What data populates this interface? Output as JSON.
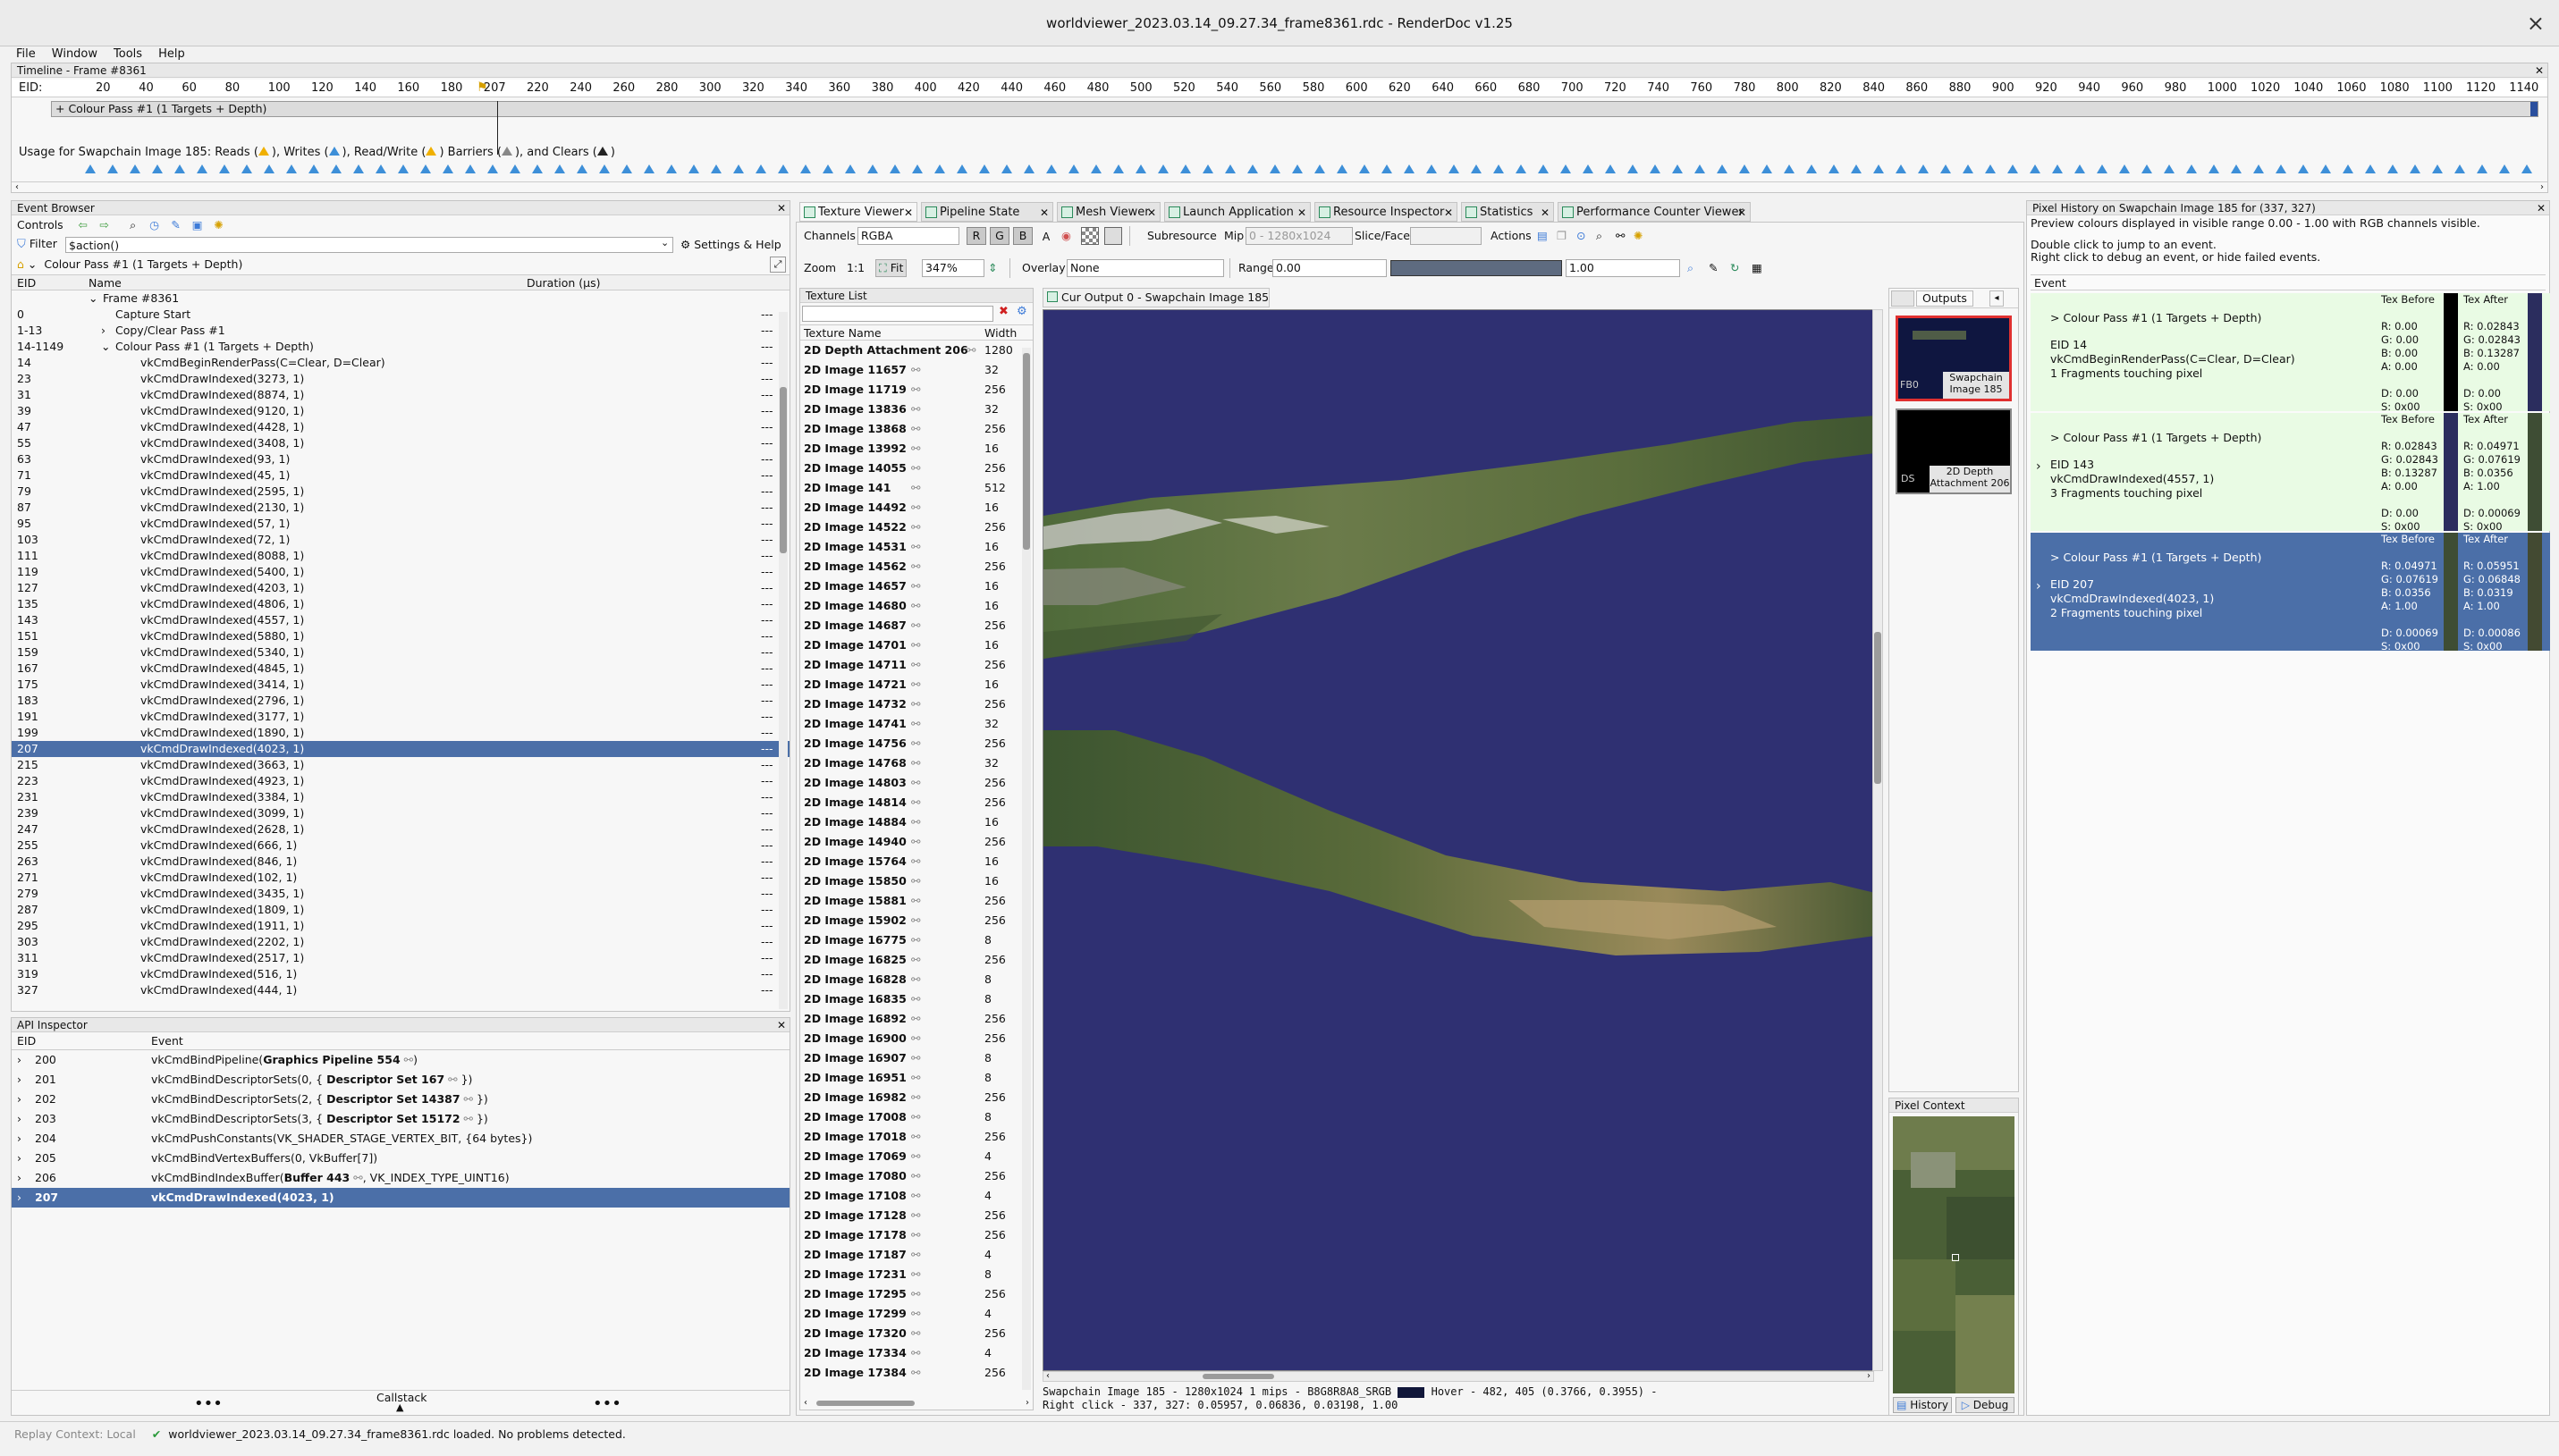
{
  "window": {
    "title": "worldviewer_2023.03.14_09.27.34_frame8361.rdc - RenderDoc v1.25",
    "close": "×"
  },
  "menu": [
    "File",
    "Window",
    "Tools",
    "Help"
  ],
  "timeline": {
    "title": "Timeline - Frame #8361",
    "eid_label": "EID:",
    "ticks": [
      "20",
      "40",
      "60",
      "80",
      "100",
      "120",
      "140",
      "160",
      "180",
      "207",
      "220",
      "240",
      "260",
      "280",
      "300",
      "320",
      "340",
      "360",
      "380",
      "400",
      "420",
      "440",
      "460",
      "480",
      "500",
      "520",
      "540",
      "560",
      "580",
      "600",
      "620",
      "640",
      "660",
      "680",
      "700",
      "720",
      "740",
      "760",
      "780",
      "800",
      "820",
      "840",
      "860",
      "880",
      "900",
      "920",
      "940",
      "960",
      "980",
      "1000",
      "1020",
      "1040",
      "1060",
      "1080",
      "1100",
      "1120",
      "1140"
    ],
    "pass_label": "+ Colour Pass #1 (1 Targets + Depth)",
    "usage_prefix": "Usage for Swapchain Image 185: Reads (",
    "usage_mid1": "), Writes (",
    "usage_mid2": "), Read/Write (",
    "usage_mid3": ") Barriers (",
    "usage_mid4": "), and Clears (",
    "usage_end": ")"
  },
  "event_browser": {
    "title": "Event Browser",
    "controls_label": "Controls",
    "filter_label": "Filter",
    "filter_value": "$action()",
    "settings_label": "Settings & Help",
    "breadcrumb": "Colour Pass #1 (1 Targets + Depth)",
    "col_eid": "EID",
    "col_name": "Name",
    "col_duration": "Duration (µs)",
    "rows": [
      {
        "eid": "",
        "name": "Frame #8361",
        "indent": 1,
        "exp": "⌄",
        "dur": ""
      },
      {
        "eid": "0",
        "name": "Capture Start",
        "indent": 2,
        "exp": "",
        "dur": "---"
      },
      {
        "eid": "1-13",
        "name": "Copy/Clear Pass #1",
        "indent": 2,
        "exp": "›",
        "dur": "---"
      },
      {
        "eid": "14-1149",
        "name": "Colour Pass #1 (1 Targets + Depth)",
        "indent": 2,
        "exp": "⌄",
        "dur": "---"
      },
      {
        "eid": "14",
        "name": "vkCmdBeginRenderPass(C=Clear, D=Clear)",
        "indent": 3,
        "exp": "",
        "dur": "---"
      },
      {
        "eid": "23",
        "name": "vkCmdDrawIndexed(3273, 1)",
        "indent": 3,
        "exp": "",
        "dur": "---"
      },
      {
        "eid": "31",
        "name": "vkCmdDrawIndexed(8874, 1)",
        "indent": 3,
        "exp": "",
        "dur": "---"
      },
      {
        "eid": "39",
        "name": "vkCmdDrawIndexed(9120, 1)",
        "indent": 3,
        "exp": "",
        "dur": "---"
      },
      {
        "eid": "47",
        "name": "vkCmdDrawIndexed(4428, 1)",
        "indent": 3,
        "exp": "",
        "dur": "---"
      },
      {
        "eid": "55",
        "name": "vkCmdDrawIndexed(3408, 1)",
        "indent": 3,
        "exp": "",
        "dur": "---"
      },
      {
        "eid": "63",
        "name": "vkCmdDrawIndexed(93, 1)",
        "indent": 3,
        "exp": "",
        "dur": "---"
      },
      {
        "eid": "71",
        "name": "vkCmdDrawIndexed(45, 1)",
        "indent": 3,
        "exp": "",
        "dur": "---"
      },
      {
        "eid": "79",
        "name": "vkCmdDrawIndexed(2595, 1)",
        "indent": 3,
        "exp": "",
        "dur": "---"
      },
      {
        "eid": "87",
        "name": "vkCmdDrawIndexed(2130, 1)",
        "indent": 3,
        "exp": "",
        "dur": "---"
      },
      {
        "eid": "95",
        "name": "vkCmdDrawIndexed(57, 1)",
        "indent": 3,
        "exp": "",
        "dur": "---"
      },
      {
        "eid": "103",
        "name": "vkCmdDrawIndexed(72, 1)",
        "indent": 3,
        "exp": "",
        "dur": "---"
      },
      {
        "eid": "111",
        "name": "vkCmdDrawIndexed(8088, 1)",
        "indent": 3,
        "exp": "",
        "dur": "---"
      },
      {
        "eid": "119",
        "name": "vkCmdDrawIndexed(5400, 1)",
        "indent": 3,
        "exp": "",
        "dur": "---"
      },
      {
        "eid": "127",
        "name": "vkCmdDrawIndexed(4203, 1)",
        "indent": 3,
        "exp": "",
        "dur": "---"
      },
      {
        "eid": "135",
        "name": "vkCmdDrawIndexed(4806, 1)",
        "indent": 3,
        "exp": "",
        "dur": "---"
      },
      {
        "eid": "143",
        "name": "vkCmdDrawIndexed(4557, 1)",
        "indent": 3,
        "exp": "",
        "dur": "---"
      },
      {
        "eid": "151",
        "name": "vkCmdDrawIndexed(5880, 1)",
        "indent": 3,
        "exp": "",
        "dur": "---"
      },
      {
        "eid": "159",
        "name": "vkCmdDrawIndexed(5340, 1)",
        "indent": 3,
        "exp": "",
        "dur": "---"
      },
      {
        "eid": "167",
        "name": "vkCmdDrawIndexed(4845, 1)",
        "indent": 3,
        "exp": "",
        "dur": "---"
      },
      {
        "eid": "175",
        "name": "vkCmdDrawIndexed(3414, 1)",
        "indent": 3,
        "exp": "",
        "dur": "---"
      },
      {
        "eid": "183",
        "name": "vkCmdDrawIndexed(2796, 1)",
        "indent": 3,
        "exp": "",
        "dur": "---"
      },
      {
        "eid": "191",
        "name": "vkCmdDrawIndexed(3177, 1)",
        "indent": 3,
        "exp": "",
        "dur": "---"
      },
      {
        "eid": "199",
        "name": "vkCmdDrawIndexed(1890, 1)",
        "indent": 3,
        "exp": "",
        "dur": "---"
      },
      {
        "eid": "207",
        "name": "vkCmdDrawIndexed(4023, 1)",
        "indent": 3,
        "exp": "",
        "dur": "---",
        "selected": true
      },
      {
        "eid": "215",
        "name": "vkCmdDrawIndexed(3663, 1)",
        "indent": 3,
        "exp": "",
        "dur": "---"
      },
      {
        "eid": "223",
        "name": "vkCmdDrawIndexed(4923, 1)",
        "indent": 3,
        "exp": "",
        "dur": "---"
      },
      {
        "eid": "231",
        "name": "vkCmdDrawIndexed(3384, 1)",
        "indent": 3,
        "exp": "",
        "dur": "---"
      },
      {
        "eid": "239",
        "name": "vkCmdDrawIndexed(3099, 1)",
        "indent": 3,
        "exp": "",
        "dur": "---"
      },
      {
        "eid": "247",
        "name": "vkCmdDrawIndexed(2628, 1)",
        "indent": 3,
        "exp": "",
        "dur": "---"
      },
      {
        "eid": "255",
        "name": "vkCmdDrawIndexed(666, 1)",
        "indent": 3,
        "exp": "",
        "dur": "---"
      },
      {
        "eid": "263",
        "name": "vkCmdDrawIndexed(846, 1)",
        "indent": 3,
        "exp": "",
        "dur": "---"
      },
      {
        "eid": "271",
        "name": "vkCmdDrawIndexed(102, 1)",
        "indent": 3,
        "exp": "",
        "dur": "---"
      },
      {
        "eid": "279",
        "name": "vkCmdDrawIndexed(3435, 1)",
        "indent": 3,
        "exp": "",
        "dur": "---"
      },
      {
        "eid": "287",
        "name": "vkCmdDrawIndexed(1809, 1)",
        "indent": 3,
        "exp": "",
        "dur": "---"
      },
      {
        "eid": "295",
        "name": "vkCmdDrawIndexed(1911, 1)",
        "indent": 3,
        "exp": "",
        "dur": "---"
      },
      {
        "eid": "303",
        "name": "vkCmdDrawIndexed(2202, 1)",
        "indent": 3,
        "exp": "",
        "dur": "---"
      },
      {
        "eid": "311",
        "name": "vkCmdDrawIndexed(2517, 1)",
        "indent": 3,
        "exp": "",
        "dur": "---"
      },
      {
        "eid": "319",
        "name": "vkCmdDrawIndexed(516, 1)",
        "indent": 3,
        "exp": "",
        "dur": "---"
      },
      {
        "eid": "327",
        "name": "vkCmdDrawIndexed(444, 1)",
        "indent": 3,
        "exp": "",
        "dur": "---"
      }
    ]
  },
  "api_inspector": {
    "title": "API Inspector",
    "col_eid": "EID",
    "col_event": "Event",
    "rows": [
      {
        "eid": "200",
        "pre": "vkCmdBindPipeline(",
        "bold": "Graphics Pipeline 554",
        "post": ")"
      },
      {
        "eid": "201",
        "pre": "vkCmdBindDescriptorSets(0, {  ",
        "bold": "Descriptor Set 167",
        "post": "  })"
      },
      {
        "eid": "202",
        "pre": "vkCmdBindDescriptorSets(2, {  ",
        "bold": "Descriptor Set 14387",
        "post": "  })"
      },
      {
        "eid": "203",
        "pre": "vkCmdBindDescriptorSets(3, {  ",
        "bold": "Descriptor Set 15172",
        "post": "  })"
      },
      {
        "eid": "204",
        "pre": "vkCmdPushConstants(VK_SHADER_STAGE_VERTEX_BIT, {64 bytes})",
        "bold": "",
        "post": ""
      },
      {
        "eid": "205",
        "pre": "vkCmdBindVertexBuffers(0, VkBuffer[7])",
        "bold": "",
        "post": ""
      },
      {
        "eid": "206",
        "pre": "vkCmdBindIndexBuffer(",
        "bold": "Buffer 443",
        "post": ", VK_INDEX_TYPE_UINT16)"
      },
      {
        "eid": "207",
        "pre": "vkCmdDrawIndexed(4023, 1)",
        "bold": "",
        "post": "",
        "selected": true
      }
    ],
    "callstack_label": "Callstack"
  },
  "tabs": [
    "Texture Viewer",
    "Pipeline State",
    "Mesh Viewer",
    "Launch Application",
    "Resource Inspector",
    "Statistics",
    "Performance Counter Viewer"
  ],
  "texture_viewer": {
    "channels_label": "Channels",
    "channels_value": "RGBA",
    "rgba_buttons": [
      "R",
      "G",
      "B",
      "A"
    ],
    "subresource_label": "Subresource",
    "mip_label": "Mip",
    "mip_value": "0 - 1280x1024",
    "slice_label": "Slice/Face",
    "actions_label": "Actions",
    "zoom_label": "Zoom",
    "zoom_11": "1:1",
    "fit_label": "Fit",
    "zoom_value": "347%",
    "overlay_label": "Overlay",
    "overlay_value": "None",
    "range_label": "Range",
    "range_min": "0.00",
    "range_max": "1.00",
    "output_tab": "Cur Output 0 - Swapchain Image 185",
    "status_line1": "Swapchain Image 185 - 1280x1024 1 mips - B8G8R8A8_SRGB",
    "hover_text": "Hover -    482,  405 (0.3766, 0.3955)  -",
    "status_line2": "Right click -   337,  327: 0.05957, 0.06836, 0.03198, 1.00",
    "hover_swatch": "#11173a"
  },
  "texture_list": {
    "title": "Texture List",
    "col_name": "Texture Name",
    "col_width": "Width",
    "items": [
      {
        "name": "2D Depth Attachment 206",
        "w": "1280"
      },
      {
        "name": "2D Image 11657",
        "w": "32"
      },
      {
        "name": "2D Image 11719",
        "w": "256"
      },
      {
        "name": "2D Image 13836",
        "w": "32"
      },
      {
        "name": "2D Image 13868",
        "w": "256"
      },
      {
        "name": "2D Image 13992",
        "w": "16"
      },
      {
        "name": "2D Image 14055",
        "w": "256"
      },
      {
        "name": "2D Image 141",
        "w": "512"
      },
      {
        "name": "2D Image 14492",
        "w": "16"
      },
      {
        "name": "2D Image 14522",
        "w": "256"
      },
      {
        "name": "2D Image 14531",
        "w": "16"
      },
      {
        "name": "2D Image 14562",
        "w": "256"
      },
      {
        "name": "2D Image 14657",
        "w": "16"
      },
      {
        "name": "2D Image 14680",
        "w": "16"
      },
      {
        "name": "2D Image 14687",
        "w": "256"
      },
      {
        "name": "2D Image 14701",
        "w": "16"
      },
      {
        "name": "2D Image 14711",
        "w": "256"
      },
      {
        "name": "2D Image 14721",
        "w": "16"
      },
      {
        "name": "2D Image 14732",
        "w": "256"
      },
      {
        "name": "2D Image 14741",
        "w": "32"
      },
      {
        "name": "2D Image 14756",
        "w": "256"
      },
      {
        "name": "2D Image 14768",
        "w": "32"
      },
      {
        "name": "2D Image 14803",
        "w": "256"
      },
      {
        "name": "2D Image 14814",
        "w": "256"
      },
      {
        "name": "2D Image 14884",
        "w": "16"
      },
      {
        "name": "2D Image 14940",
        "w": "256"
      },
      {
        "name": "2D Image 15764",
        "w": "16"
      },
      {
        "name": "2D Image 15850",
        "w": "16"
      },
      {
        "name": "2D Image 15881",
        "w": "256"
      },
      {
        "name": "2D Image 15902",
        "w": "256"
      },
      {
        "name": "2D Image 16775",
        "w": "8"
      },
      {
        "name": "2D Image 16825",
        "w": "256"
      },
      {
        "name": "2D Image 16828",
        "w": "8"
      },
      {
        "name": "2D Image 16835",
        "w": "8"
      },
      {
        "name": "2D Image 16892",
        "w": "256"
      },
      {
        "name": "2D Image 16900",
        "w": "256"
      },
      {
        "name": "2D Image 16907",
        "w": "8"
      },
      {
        "name": "2D Image 16951",
        "w": "8"
      },
      {
        "name": "2D Image 16982",
        "w": "256"
      },
      {
        "name": "2D Image 17008",
        "w": "8"
      },
      {
        "name": "2D Image 17018",
        "w": "256"
      },
      {
        "name": "2D Image 17069",
        "w": "4"
      },
      {
        "name": "2D Image 17080",
        "w": "256"
      },
      {
        "name": "2D Image 17108",
        "w": "4"
      },
      {
        "name": "2D Image 17128",
        "w": "256"
      },
      {
        "name": "2D Image 17178",
        "w": "256"
      },
      {
        "name": "2D Image 17187",
        "w": "4"
      },
      {
        "name": "2D Image 17231",
        "w": "8"
      },
      {
        "name": "2D Image 17295",
        "w": "256"
      },
      {
        "name": "2D Image 17299",
        "w": "4"
      },
      {
        "name": "2D Image 17320",
        "w": "256"
      },
      {
        "name": "2D Image 17334",
        "w": "4"
      },
      {
        "name": "2D Image 17384",
        "w": "256"
      }
    ]
  },
  "outputs": {
    "title": "Outputs",
    "items": [
      {
        "tag": "FB0",
        "label1": "Swapchain",
        "label2": "Image 185",
        "selected": true
      },
      {
        "tag": "DS",
        "label1": "2D Depth",
        "label2": "Attachment 206",
        "selected": false
      }
    ],
    "pixel_context_title": "Pixel Context",
    "history_button": "History",
    "debug_button": "Debug"
  },
  "pixel_history": {
    "title": "Pixel History on Swapchain Image 185 for (337, 327)",
    "info1": "Preview colours displayed in visible range 0.00 - 1.00 with RGB channels visible.",
    "info2": "Double click to jump to an event.",
    "info3": "Right click to debug an event, or hide failed events.",
    "col_event": "Event",
    "col_before": "Tex Before",
    "col_after": "Tex After",
    "entries": [
      {
        "pass": "> Colour Pass #1 (1 Targets + Depth)",
        "eid": "EID 14",
        "call": "vkCmdBeginRenderPass(C=Clear, D=Clear)",
        "frags": "1 Fragments touching pixel",
        "before": [
          "R: 0.00",
          "G: 0.00",
          "B: 0.00",
          "A: 0.00",
          "",
          "D: 0.00",
          "S: 0x00"
        ],
        "after": [
          "R: 0.02843",
          "G: 0.02843",
          "B: 0.13287",
          "A: 0.00",
          "",
          "D: 0.00",
          "S: 0x00"
        ],
        "expander": "",
        "selected": false,
        "before_color": "#000000",
        "after_color": "#2b2d5e"
      },
      {
        "pass": "> Colour Pass #1 (1 Targets + Depth)",
        "eid": "EID 143",
        "call": "vkCmdDrawIndexed(4557, 1)",
        "frags": "3 Fragments touching pixel",
        "before": [
          "R: 0.02843",
          "G: 0.02843",
          "B: 0.13287",
          "A: 0.00",
          "",
          "D: 0.00",
          "S: 0x00"
        ],
        "after": [
          "R: 0.04971",
          "G: 0.07619",
          "B: 0.0356",
          "A: 1.00",
          "",
          "D: 0.00069",
          "S: 0x00"
        ],
        "expander": "›",
        "selected": false,
        "before_color": "#2b2d5e",
        "after_color": "#3e4d34"
      },
      {
        "pass": "> Colour Pass #1 (1 Targets + Depth)",
        "eid": "EID 207",
        "call": "vkCmdDrawIndexed(4023, 1)",
        "frags": "2 Fragments touching pixel",
        "before": [
          "R: 0.04971",
          "G: 0.07619",
          "B: 0.0356",
          "A: 1.00",
          "",
          "D: 0.00069",
          "S: 0x00"
        ],
        "after": [
          "R: 0.05951",
          "G: 0.06848",
          "B: 0.0319",
          "A: 1.00",
          "",
          "D: 0.00086",
          "S: 0x00"
        ],
        "expander": "›",
        "selected": true,
        "before_color": "#3e4d34",
        "after_color": "#434a32"
      }
    ]
  },
  "statusbar": {
    "replay": "Replay Context: Local",
    "message": "worldviewer_2023.03.14_09.27.34_frame8361.rdc loaded. No problems detected."
  }
}
